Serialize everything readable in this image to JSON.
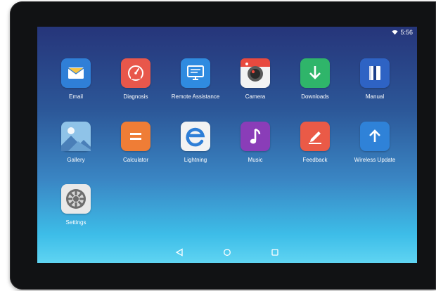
{
  "status": {
    "time": "5:56",
    "wifi_icon": "wifi-icon"
  },
  "apps": [
    {
      "label": "Email",
      "icon": "email-icon",
      "color": "#2f7fd7"
    },
    {
      "label": "Diagnosis",
      "icon": "gauge-icon",
      "color": "#e8574b"
    },
    {
      "label": "Remote Assistance",
      "icon": "monitor-icon",
      "color": "#2f8be0"
    },
    {
      "label": "Camera",
      "icon": "camera-icon",
      "color": "#f3f3f3"
    },
    {
      "label": "Downloads",
      "icon": "download-icon",
      "color": "#2fb56a"
    },
    {
      "label": "Manual",
      "icon": "book-icon",
      "color": "#2e63c4"
    },
    {
      "label": "Gallery",
      "icon": "gallery-icon",
      "color": "#8fc3e8"
    },
    {
      "label": "Calculator",
      "icon": "calculator-icon",
      "color": "#ef7d36"
    },
    {
      "label": "Lightning",
      "icon": "browser-e-icon",
      "color": "#f3f3f3"
    },
    {
      "label": "Music",
      "icon": "music-note-icon",
      "color": "#8a3db8"
    },
    {
      "label": "Feedback",
      "icon": "pencil-icon",
      "color": "#ea5a47"
    },
    {
      "label": "Wireless Update",
      "icon": "upload-arrow-icon",
      "color": "#2f82d8"
    },
    {
      "label": "Settings",
      "icon": "gear-icon",
      "color": "#e9e9e9"
    }
  ],
  "navbar": {
    "back": "back-icon",
    "home": "home-icon",
    "recents": "recents-icon"
  }
}
